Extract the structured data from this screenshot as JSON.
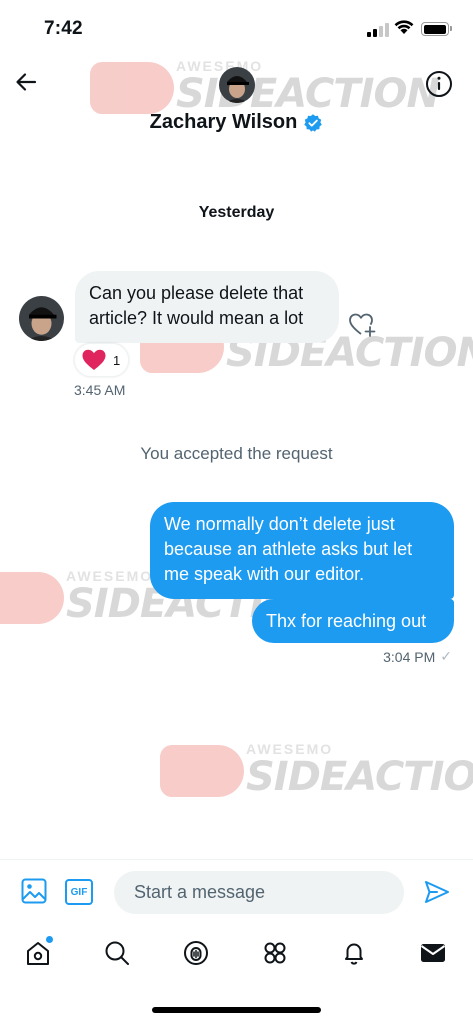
{
  "status_bar": {
    "time": "7:42",
    "battery_level": 0.9
  },
  "header": {
    "contact_name": "Zachary Wilson",
    "verified": true,
    "back_icon": "arrow-left-icon",
    "info_icon": "info-icon"
  },
  "conversation": {
    "date_separator": "Yesterday",
    "received_message": {
      "text": "Can you please delete that article? It would mean a lot",
      "reaction_emoji": "heart",
      "reaction_count": "1",
      "time": "3:45 AM"
    },
    "system_message": "You accepted the request",
    "sent_messages": [
      {
        "text": "We normally don’t delete just because an athlete asks but let me speak with our editor."
      },
      {
        "text": "Thx for reaching out"
      }
    ],
    "sent_time": "3:04 PM",
    "sent_status": "✓"
  },
  "watermark": {
    "top": "AWESEMO",
    "main": "SIDEACTION"
  },
  "composer": {
    "placeholder": "Start a message",
    "gif_label": "GIF"
  },
  "tabbar": {
    "items": [
      "home-icon",
      "search-icon",
      "spaces-icon",
      "communities-icon",
      "notifications-icon",
      "messages-icon"
    ],
    "accent_color": "#1d9bf0"
  },
  "colors": {
    "accent": "#1d9bf0",
    "bubble_received": "#eff3f4",
    "secondary_text": "#536471"
  }
}
